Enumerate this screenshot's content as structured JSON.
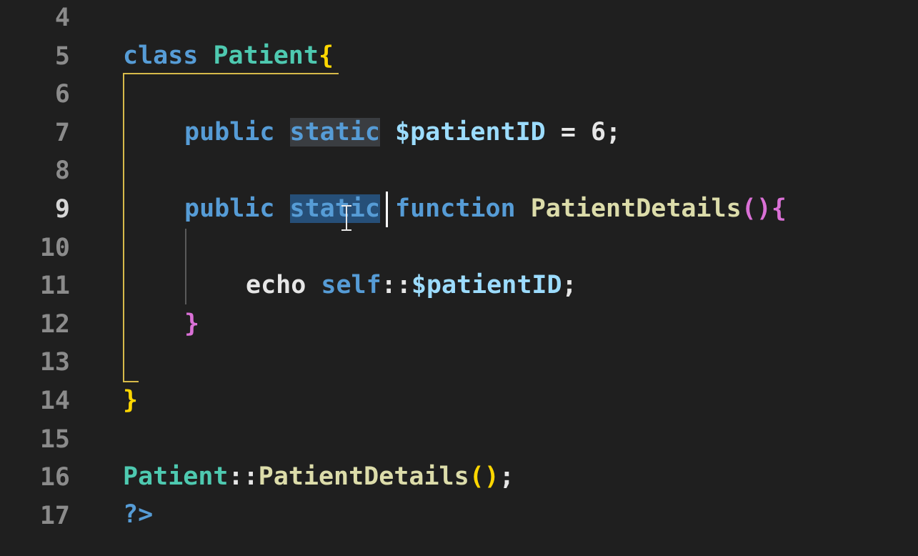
{
  "gutter": [
    "4",
    "5",
    "6",
    "7",
    "8",
    "9",
    "10",
    "11",
    "12",
    "13",
    "14",
    "15",
    "16",
    "17"
  ],
  "active_line": "9",
  "colors": {
    "keyword": "#569cd6",
    "class": "#4ec9b0",
    "variable": "#9cdcfe",
    "function": "#dcdcaa",
    "bracket_gold": "#ffd700",
    "bracket_pink": "#da70d6",
    "guide": "#d7ba4a"
  },
  "lines": {
    "l5": {
      "kw": "class",
      "cls": "Patient",
      "brace": "{"
    },
    "l7": {
      "kw": "public",
      "static": "static",
      "var": "$patientID",
      "rest": " = 6;"
    },
    "l9": {
      "kw": "public",
      "static": "static",
      "fnkw": "function",
      "fn": "PatientDetails",
      "paren_open": "(",
      "paren_close": ")",
      "brace": "{"
    },
    "l11": {
      "echo": "echo",
      "self": "self",
      "sep": "::",
      "var": "$patientID",
      "semi": ";"
    },
    "l12": {
      "brace": "}"
    },
    "l14": {
      "brace": "}"
    },
    "l16": {
      "cls": "Patient",
      "sep": "::",
      "fn": "PatientDetails",
      "paren_open": "(",
      "paren_close": ")",
      "semi": ";"
    },
    "l17": {
      "tag": "?>"
    }
  }
}
